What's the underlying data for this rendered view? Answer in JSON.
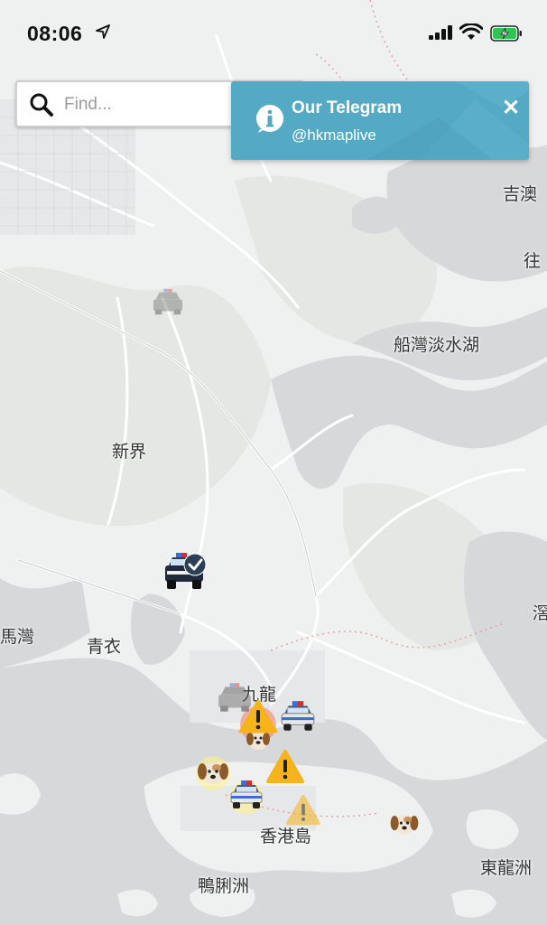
{
  "status_bar": {
    "time": "08:06"
  },
  "search": {
    "placeholder": "Find..."
  },
  "banner": {
    "title": "Our Telegram",
    "subtitle": "@hkmaplive"
  },
  "places": {
    "kat_o": "吉澳",
    "chu": "往",
    "plover_cove": "船灣淡水湖",
    "new_territories": "新界",
    "ma_wan": "馬灣",
    "tsing_yi": "青衣",
    "kowloon": "九龍",
    "hk_island": "香港島",
    "ap_lei_chau": "鴨脷洲",
    "tung_lung_chau": "東龍洲",
    "sai_kung_edge": "滘"
  },
  "markers": {
    "police_van": "police-van",
    "warning": "warning",
    "dog": "dog"
  },
  "colors": {
    "banner": "#54a9c4",
    "water": "#d6d8da",
    "land": "#eff0f0",
    "warning": "#f6b31b"
  }
}
